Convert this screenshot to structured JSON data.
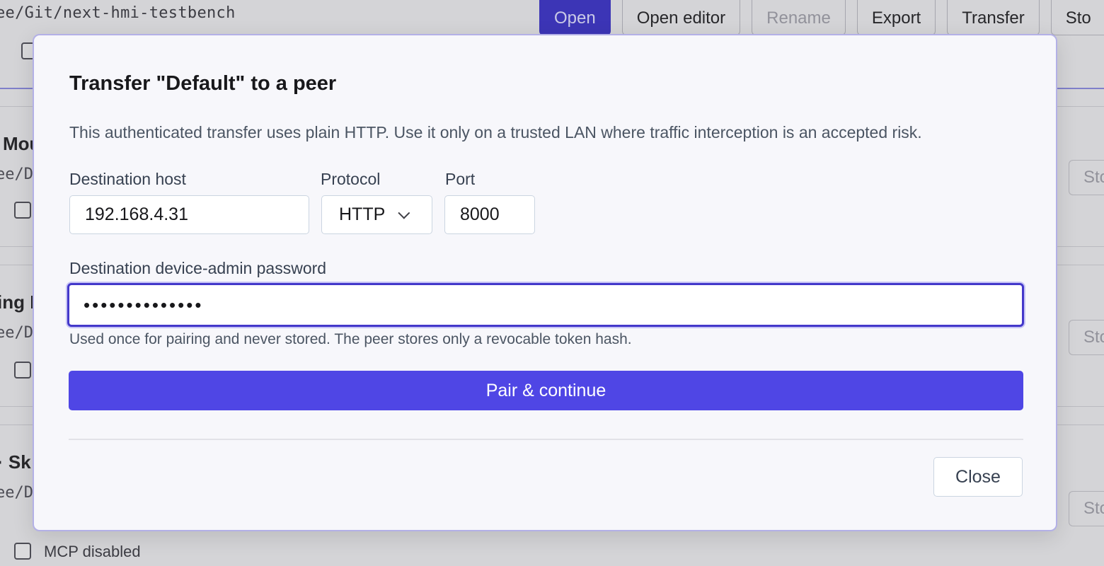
{
  "background": {
    "repo_path": "ee/Git/next-hmi-testbench",
    "toolbar": [
      {
        "label": "Open",
        "style": "primary"
      },
      {
        "label": "Open editor",
        "style": "normal"
      },
      {
        "label": "Rename",
        "style": "disabled"
      },
      {
        "label": "Export",
        "style": "normal"
      },
      {
        "label": "Transfer",
        "style": "normal"
      },
      {
        "label": "Sto",
        "style": "cut"
      }
    ],
    "cards": [
      {
        "title": "Mou",
        "path": "ee/D",
        "side_button": "Sto"
      },
      {
        "title": "ing I",
        "path": "ee/D",
        "side_button": "Sto"
      },
      {
        "title": "· Sk",
        "path": "ee/D",
        "side_button": "Sto"
      }
    ],
    "mcp_label": "MCP disabled"
  },
  "dialog": {
    "title": "Transfer \"Default\" to a peer",
    "description": "This authenticated transfer uses plain HTTP. Use it only on a trusted LAN where traffic interception is an accepted risk.",
    "host": {
      "label": "Destination host",
      "value": "192.168.4.31"
    },
    "protocol": {
      "label": "Protocol",
      "value": "HTTP"
    },
    "port": {
      "label": "Port",
      "value": "8000"
    },
    "password": {
      "label": "Destination device-admin password",
      "value": "••••••••••••••"
    },
    "hint": "Used once for pairing and never stored. The peer stores only a revocable token hash.",
    "primary_button": "Pair & continue",
    "close_button": "Close"
  },
  "colors": {
    "accent": "#4f46e5",
    "focus_ring": "#4338ca"
  }
}
